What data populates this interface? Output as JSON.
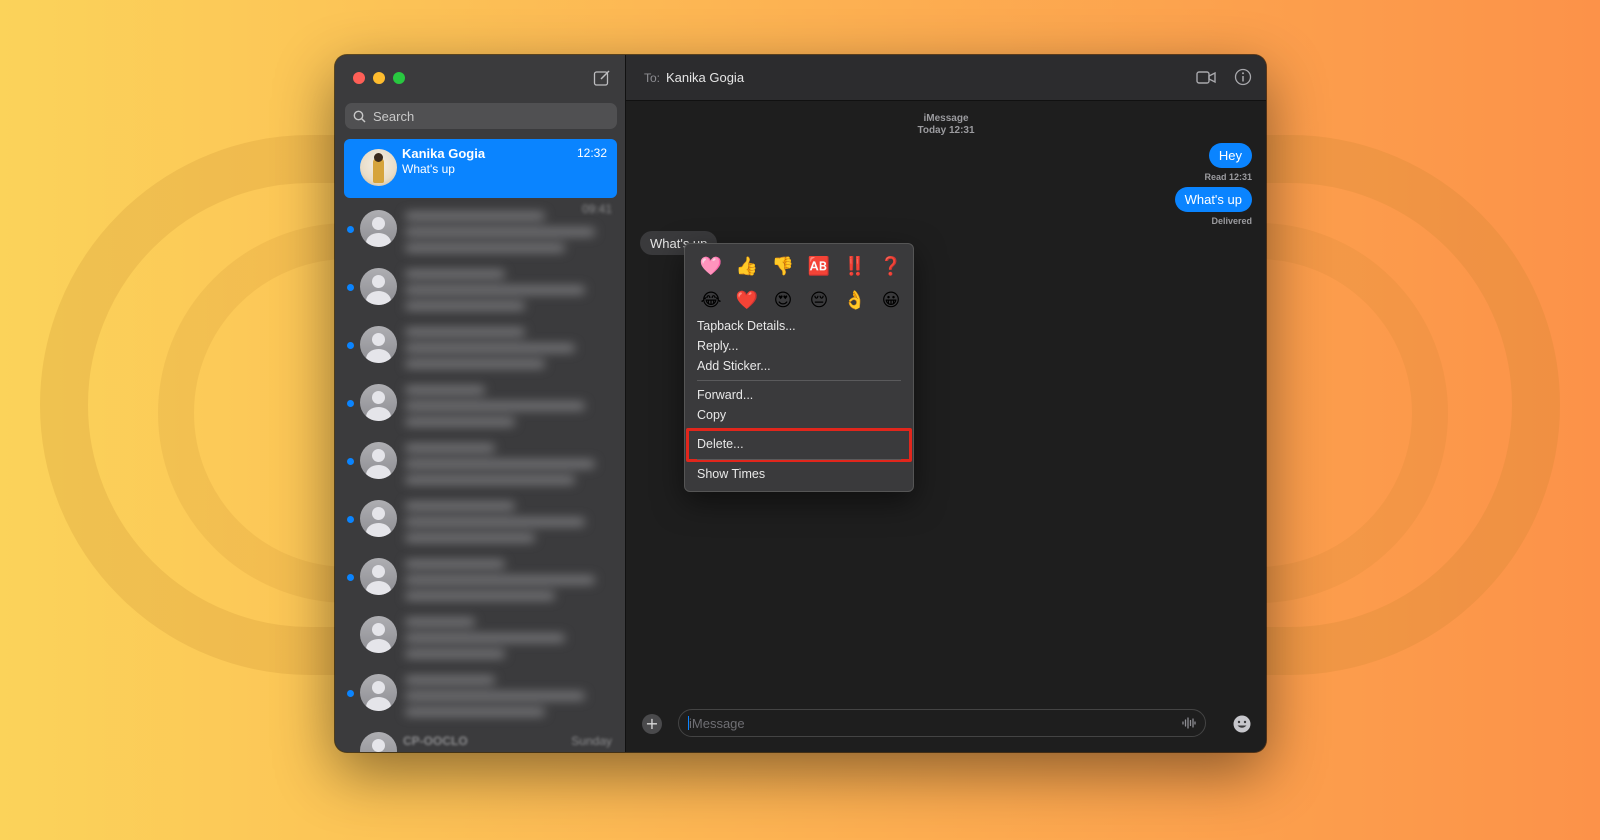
{
  "window": {
    "search": {
      "placeholder": "Search"
    }
  },
  "active_conversation": {
    "name": "Kanika Gogia",
    "time": "12:32",
    "preview": "What's up"
  },
  "blurred_conversations": {
    "first_time": "09:41",
    "last_name": "CP-OOCLO",
    "last_time": "Sunday"
  },
  "header": {
    "to_label": "To:",
    "recipient": "Kanika Gogia"
  },
  "thread": {
    "service": "iMessage",
    "date": "Today 12:31",
    "outgoing": [
      {
        "text": "Hey",
        "receipt": "Read 12:31"
      },
      {
        "text": "What's up",
        "receipt": "Delivered"
      }
    ],
    "incoming": [
      {
        "text": "What's up"
      }
    ]
  },
  "context_menu": {
    "tapbacks": [
      "🩷",
      "👍",
      "👎",
      "🆎",
      "‼️",
      "❓",
      "😂",
      "❤️",
      "😍",
      "😔",
      "👌",
      "😀"
    ],
    "items": {
      "tapback_details": "Tapback Details...",
      "reply": "Reply...",
      "add_sticker": "Add Sticker...",
      "forward": "Forward...",
      "copy": "Copy",
      "delete": "Delete...",
      "show_times": "Show Times"
    }
  },
  "composer": {
    "placeholder": "iMessage"
  },
  "colors": {
    "accent": "#0a84ff",
    "highlight": "#e1261c"
  }
}
